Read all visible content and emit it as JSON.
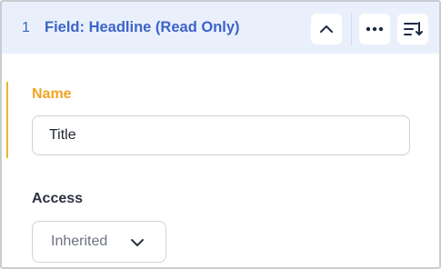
{
  "header": {
    "index": "1",
    "title": "Field: Headline (Read Only)",
    "actions": {
      "collapse_icon": "chevron-up-icon",
      "more_icon": "more-horizontal-icon",
      "sort_icon": "sort-list-icon"
    }
  },
  "form": {
    "name": {
      "label": "Name",
      "value": "Title"
    },
    "access": {
      "label": "Access",
      "selected": "Inherited",
      "chevron_icon": "chevron-down-icon"
    }
  },
  "colors": {
    "header_bg": "#eaf0fb",
    "accent_blue": "#3d63c9",
    "accent_orange": "#f0a523",
    "border": "#cdd1d7"
  }
}
